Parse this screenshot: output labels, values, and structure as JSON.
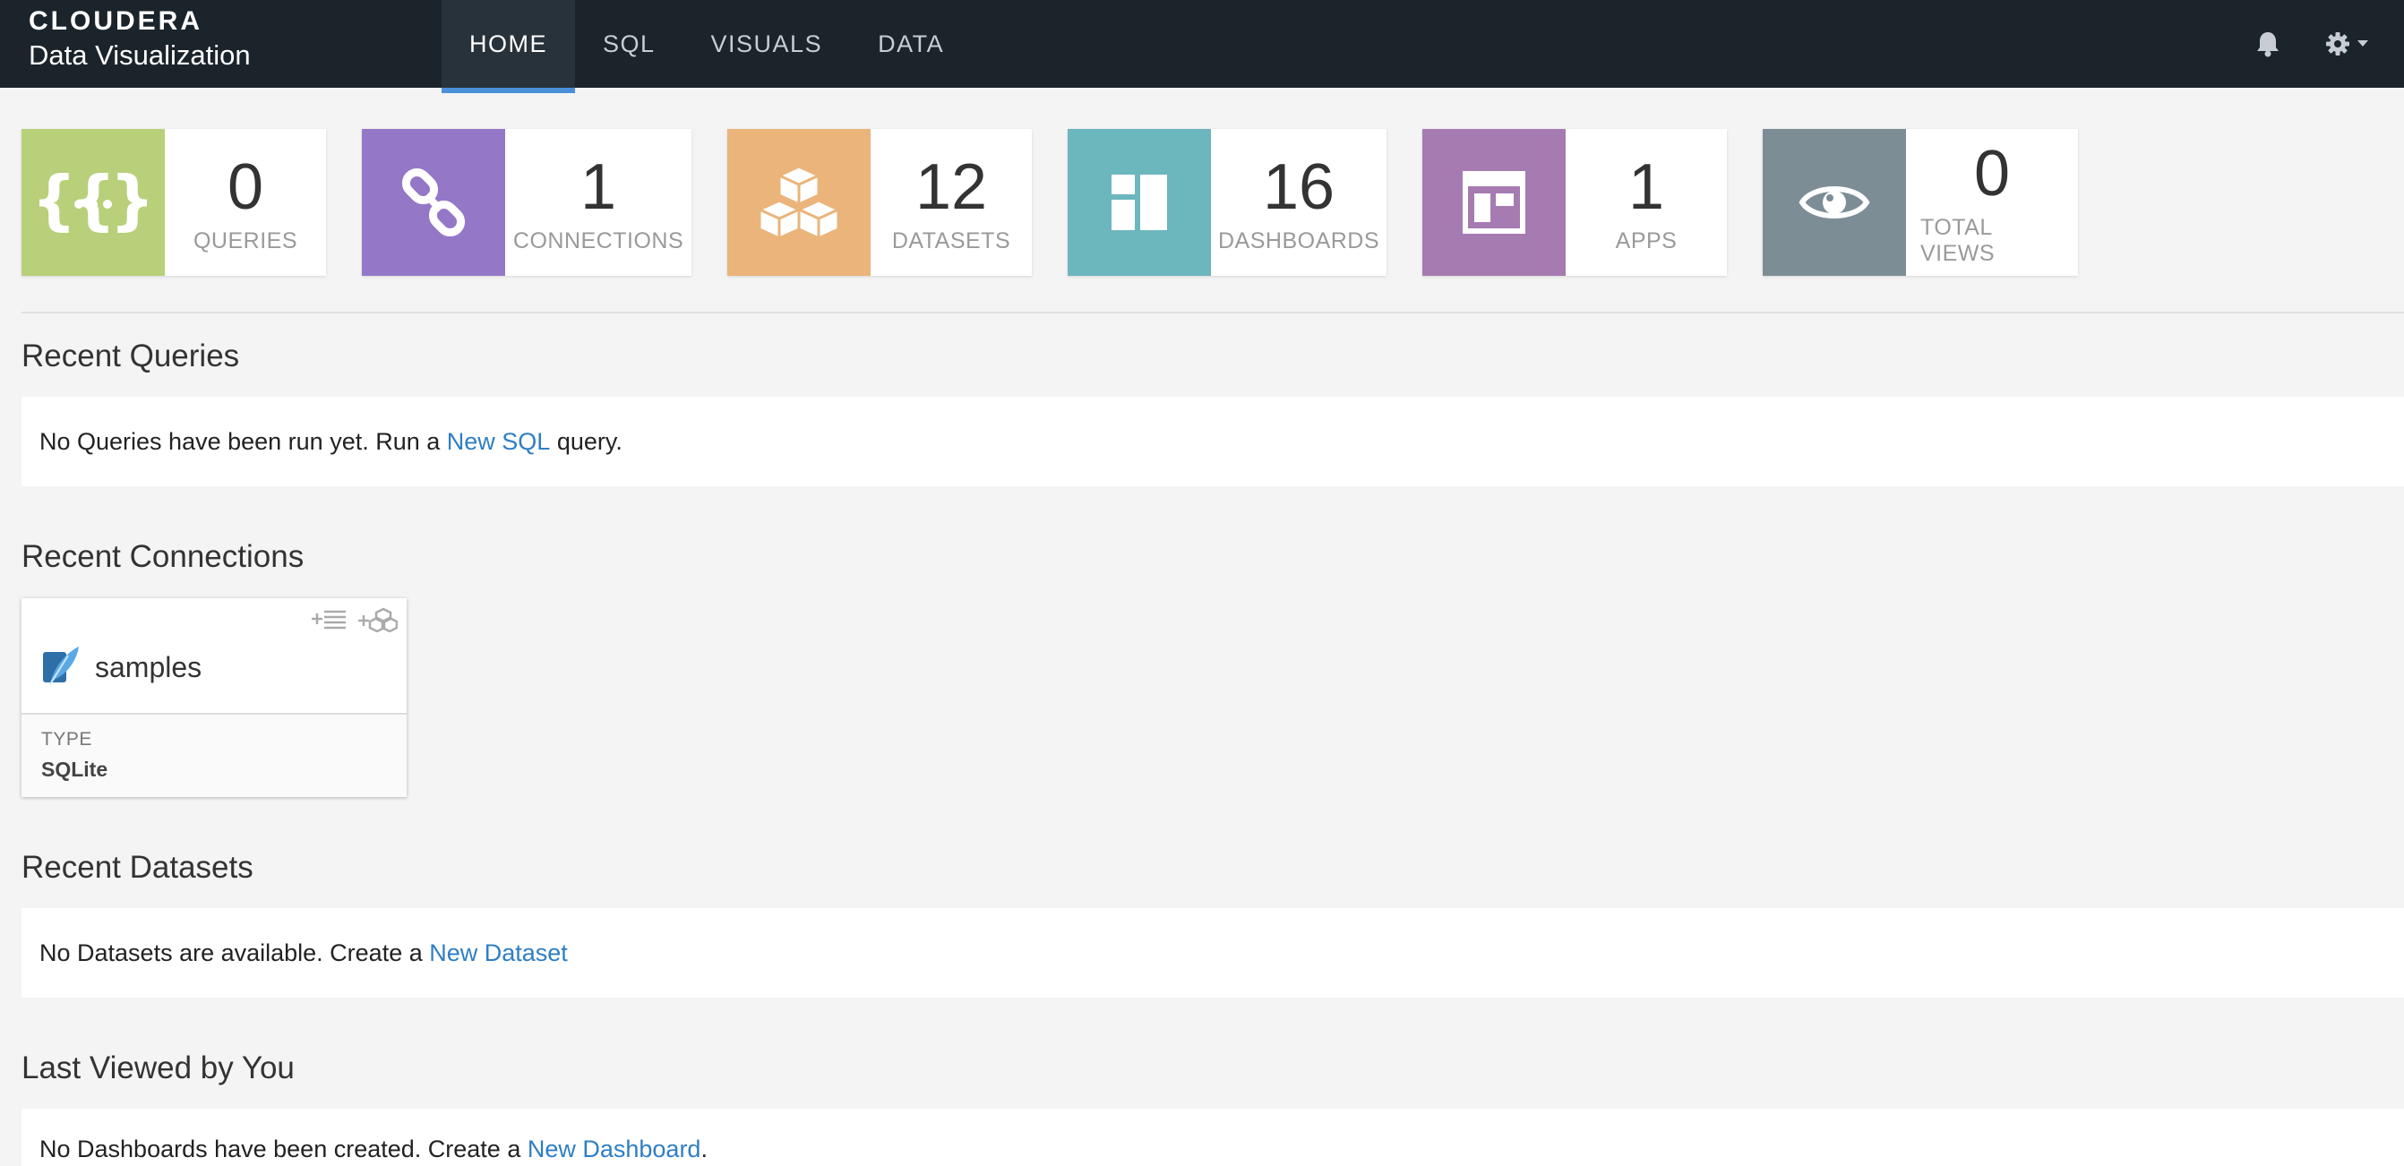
{
  "brand": {
    "logo": "CLOUDERA",
    "product": "Data Visualization"
  },
  "nav": {
    "items": [
      {
        "label": "HOME",
        "active": true
      },
      {
        "label": "SQL",
        "active": false
      },
      {
        "label": "VISUALS",
        "active": false
      },
      {
        "label": "DATA",
        "active": false
      }
    ],
    "icons": [
      "bell-icon",
      "gear-icon"
    ]
  },
  "stats": [
    {
      "value": "0",
      "label": "QUERIES",
      "color": "#b8d07a",
      "icon": "braces-icon"
    },
    {
      "value": "1",
      "label": "CONNECTIONS",
      "color": "#9478c7",
      "icon": "link-icon"
    },
    {
      "value": "12",
      "label": "DATASETS",
      "color": "#eab47a",
      "icon": "cubes-icon"
    },
    {
      "value": "16",
      "label": "DASHBOARDS",
      "color": "#6cb6be",
      "icon": "dashboard-icon"
    },
    {
      "value": "1",
      "label": "APPS",
      "color": "#a67bb1",
      "icon": "app-window-icon"
    },
    {
      "value": "0",
      "label": "TOTAL VIEWS",
      "color": "#7d8d96",
      "icon": "eye-icon"
    }
  ],
  "recent_queries": {
    "title": "Recent Queries",
    "text_before": "No Queries have been run yet. Run a ",
    "link": "New SQL",
    "text_after": " query."
  },
  "recent_connections": {
    "title": "Recent Connections",
    "cards": [
      {
        "name": "samples",
        "type_label": "TYPE",
        "type_value": "SQLite",
        "icon": "sqlite-feather-icon"
      }
    ]
  },
  "recent_datasets": {
    "title": "Recent Datasets",
    "text_before": "No Datasets are available. Create a ",
    "link": "New Dataset",
    "text_after": ""
  },
  "last_viewed": {
    "title": "Last Viewed by You",
    "text_before": "No Dashboards have been created. Create a ",
    "link": "New Dashboard",
    "text_after": "."
  },
  "colors": {
    "topbar": "#1b242b",
    "accent": "#4a90d9",
    "link": "#2f7ec4"
  }
}
